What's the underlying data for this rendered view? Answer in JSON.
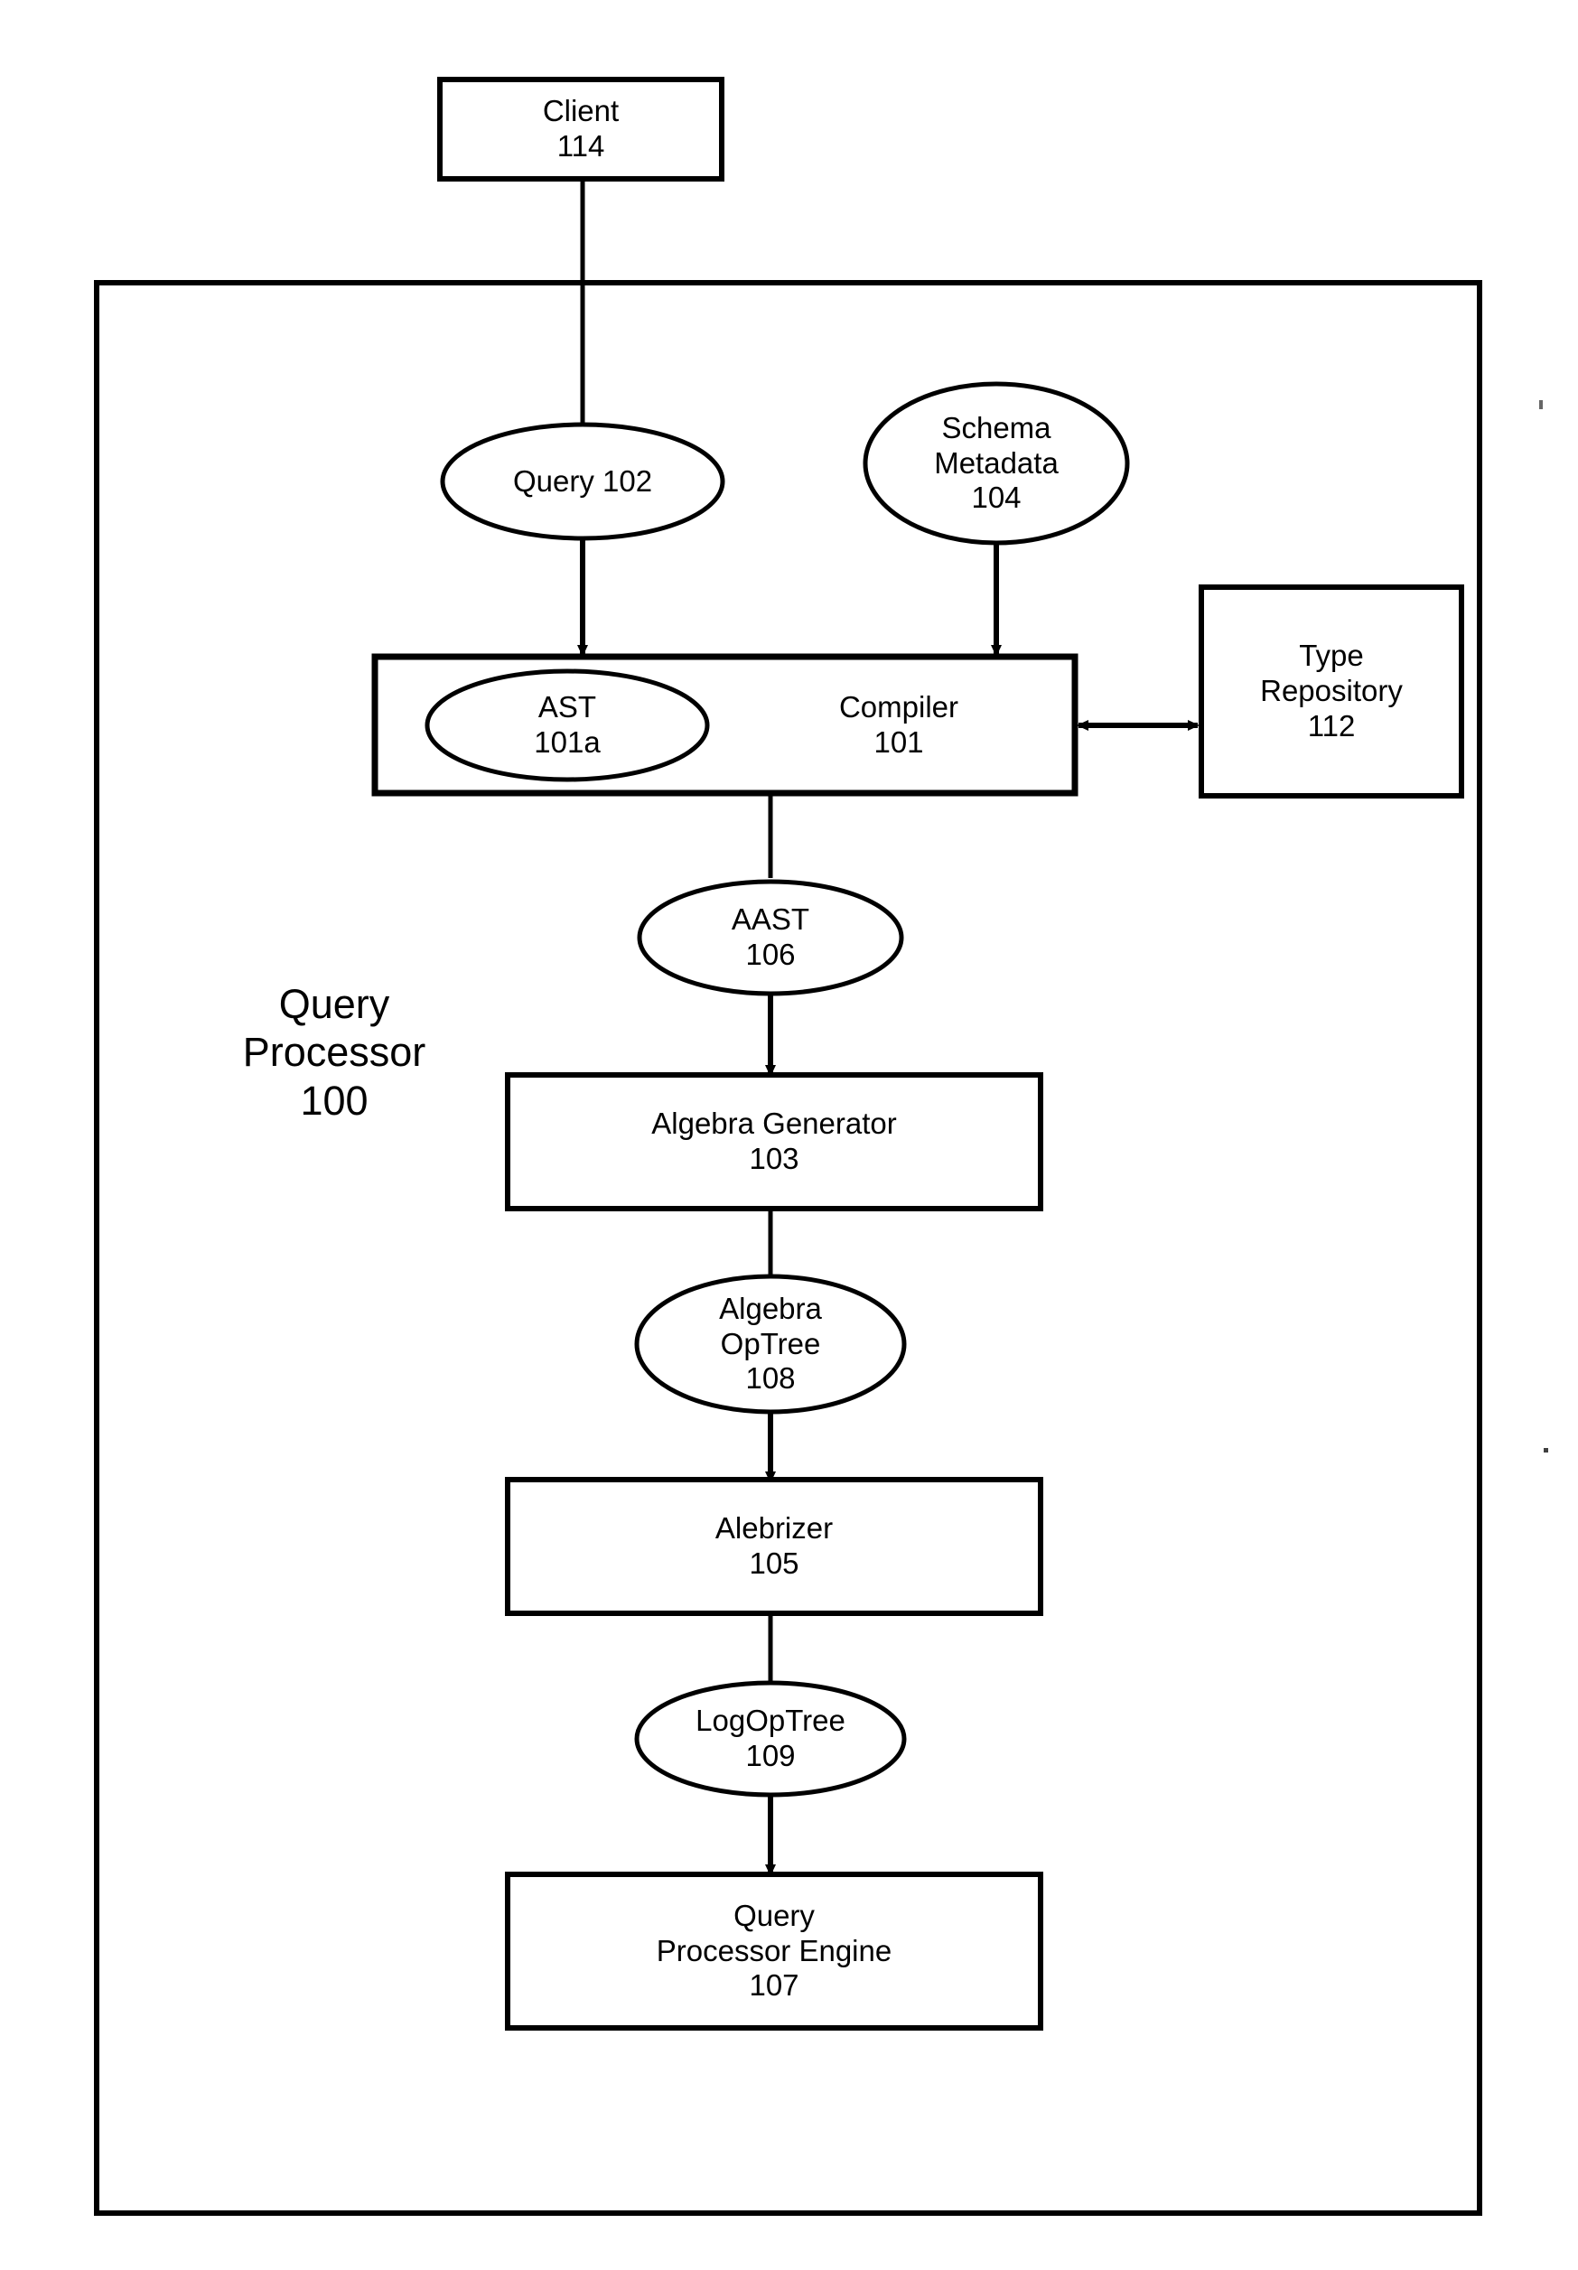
{
  "figure": {
    "kind": "patent-block-diagram",
    "background_color": "#ffffff",
    "stroke_color": "#000000"
  },
  "container": {
    "name": "Query Processor",
    "label_line1": "Query",
    "label_line2": "Processor",
    "label_line3": "100",
    "ref": "100"
  },
  "nodes": {
    "client": {
      "line1": "Client",
      "line2": "114",
      "ref": "114",
      "shape": "rect"
    },
    "query": {
      "line1": "Query 102",
      "ref": "102",
      "shape": "ellipse"
    },
    "schema_metadata": {
      "line1": "Schema",
      "line2": "Metadata",
      "line3": "104",
      "ref": "104",
      "shape": "ellipse"
    },
    "compiler": {
      "line1": "Compiler",
      "line2": "101",
      "ref": "101",
      "shape": "rect"
    },
    "ast": {
      "line1": "AST",
      "line2": "101a",
      "ref": "101a",
      "shape": "ellipse"
    },
    "type_repository": {
      "line1": "Type",
      "line2": "Repository",
      "line3": "112",
      "ref": "112",
      "shape": "rect"
    },
    "aast": {
      "line1": "AAST",
      "line2": "106",
      "ref": "106",
      "shape": "ellipse"
    },
    "algebra_generator": {
      "line1": "Algebra Generator",
      "line2": "103",
      "ref": "103",
      "shape": "rect"
    },
    "algebra_optree": {
      "line1": "Algebra",
      "line2": "OpTree",
      "line3": "108",
      "ref": "108",
      "shape": "ellipse"
    },
    "alebrizer": {
      "line1": "Alebrizer",
      "line2": "105",
      "ref": "105",
      "shape": "rect"
    },
    "logoptree": {
      "line1": "LogOpTree",
      "line2": "109",
      "ref": "109",
      "shape": "ellipse"
    },
    "query_processor_engine": {
      "line1": "Query",
      "line2": "Processor Engine",
      "line3": "107",
      "ref": "107",
      "shape": "rect"
    }
  },
  "edges": [
    {
      "from": "client",
      "to": "query",
      "arrow": "none"
    },
    {
      "from": "query",
      "to": "compiler",
      "arrow": "end"
    },
    {
      "from": "schema_metadata",
      "to": "compiler",
      "arrow": "end"
    },
    {
      "from": "compiler",
      "to": "type_repository",
      "arrow": "both"
    },
    {
      "from": "compiler",
      "to": "aast",
      "arrow": "none"
    },
    {
      "from": "aast",
      "to": "algebra_generator",
      "arrow": "end"
    },
    {
      "from": "algebra_generator",
      "to": "algebra_optree",
      "arrow": "none"
    },
    {
      "from": "algebra_optree",
      "to": "alebrizer",
      "arrow": "end"
    },
    {
      "from": "alebrizer",
      "to": "logoptree",
      "arrow": "none"
    },
    {
      "from": "logoptree",
      "to": "query_processor_engine",
      "arrow": "end"
    }
  ]
}
